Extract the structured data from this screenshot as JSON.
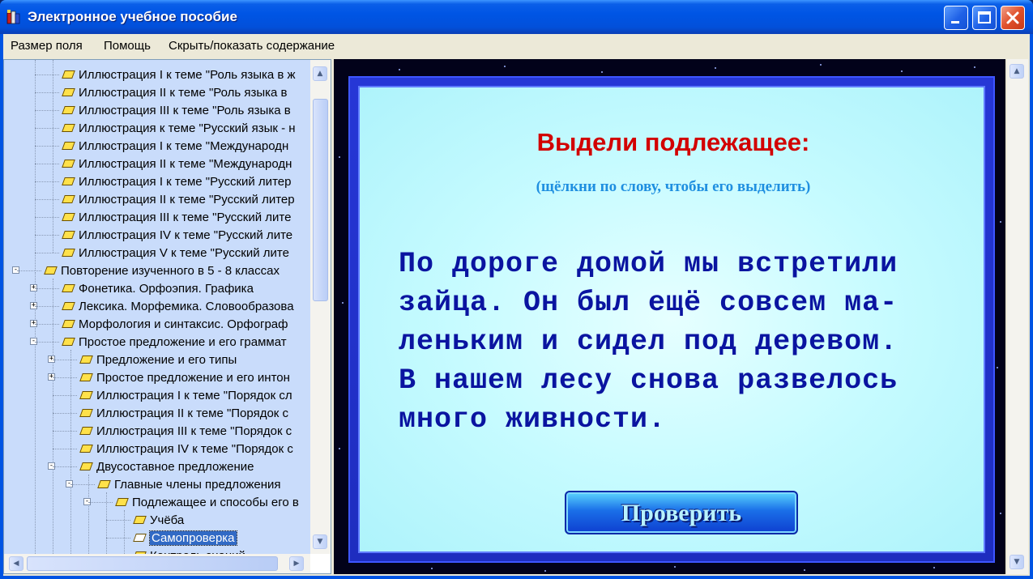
{
  "window": {
    "title": "Электронное учебное пособие"
  },
  "menu": {
    "items": [
      "Размер поля",
      "Помощь",
      "Скрыть/показать содержание"
    ]
  },
  "tree": {
    "items": [
      {
        "label": "Иллюстрация I к теме \"Роль языка в ж",
        "level": 3
      },
      {
        "label": "Иллюстрация II к теме \"Роль языка в",
        "level": 3
      },
      {
        "label": "Иллюстрация III к теме \"Роль языка в",
        "level": 3
      },
      {
        "label": "Иллюстрация к теме \"Русский язык - н",
        "level": 3
      },
      {
        "label": "Иллюстрация I к теме \"Международн",
        "level": 3
      },
      {
        "label": "Иллюстрация II к теме \"Международн",
        "level": 3
      },
      {
        "label": "Иллюстрация I к теме \"Русский литер",
        "level": 3
      },
      {
        "label": "Иллюстрация II к теме \"Русский литер",
        "level": 3
      },
      {
        "label": "Иллюстрация III к теме \"Русский лите",
        "level": 3
      },
      {
        "label": "Иллюстрация IV к теме \"Русский лите",
        "level": 3
      },
      {
        "label": "Иллюстрация V к теме \"Русский лите",
        "level": 3
      },
      {
        "label": "Повторение изученного в 5 - 8 классах",
        "level": 2,
        "expander": "−"
      },
      {
        "label": "Фонетика. Орфоэпия. Графика",
        "level": 3,
        "expander": "+"
      },
      {
        "label": "Лексика. Морфемика. Словообразова",
        "level": 3,
        "expander": "+"
      },
      {
        "label": "Морфология и синтаксис. Орфограф",
        "level": 3,
        "expander": "+"
      },
      {
        "label": "Простое предложение и его граммат",
        "level": 3,
        "expander": "−"
      },
      {
        "label": "Предложение и его типы",
        "level": 4,
        "expander": "+"
      },
      {
        "label": "Простое предложение и его интон",
        "level": 4,
        "expander": "+"
      },
      {
        "label": "Иллюстрация I к теме \"Порядок сл",
        "level": 4
      },
      {
        "label": "Иллюстрация II к теме \"Порядок с",
        "level": 4
      },
      {
        "label": "Иллюстрация III к теме \"Порядок с",
        "level": 4
      },
      {
        "label": "Иллюстрация IV к теме \"Порядок с",
        "level": 4
      },
      {
        "label": "Двусоставное предложение",
        "level": 4,
        "expander": "−"
      },
      {
        "label": "Главные члены предложения",
        "level": 5,
        "expander": "−"
      },
      {
        "label": "Подлежащее и способы его в",
        "level": 6,
        "expander": "−"
      },
      {
        "label": "Учёба",
        "level": 7
      },
      {
        "label": "Самопроверка",
        "level": 7,
        "selected": true
      },
      {
        "label": "Контроль знаний",
        "level": 7
      }
    ]
  },
  "exercise": {
    "title": "Выдели подлежащее:",
    "hint": "(щёлкни по слову, чтобы его выделить)",
    "lines": [
      "По дороге домой мы встретили",
      "зайца. Он был ещё совсем ма-",
      "леньким и сидел под деревом.",
      "В нашем лесу снова развелось",
      "много живности."
    ],
    "check_label": "Проверить"
  },
  "colors": {
    "title_red": "#d20000",
    "hint_blue": "#1f8fe0",
    "text_navy": "#0a14a0",
    "card_bg": "#c6fbff",
    "frame_blue": "#2637d6"
  }
}
